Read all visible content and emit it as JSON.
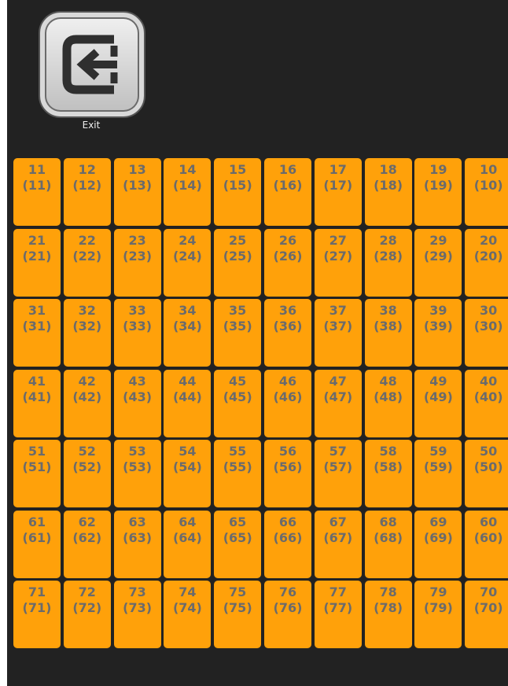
{
  "exit": {
    "label": "Exit",
    "icon": "exit-arrow-icon"
  },
  "colors": {
    "background": "#222222",
    "tile": "#ffa10a",
    "tile_text": "#6b6b6b"
  },
  "tiles": [
    {
      "num": "11",
      "sub": "(11)"
    },
    {
      "num": "12",
      "sub": "(12)"
    },
    {
      "num": "13",
      "sub": "(13)"
    },
    {
      "num": "14",
      "sub": "(14)"
    },
    {
      "num": "15",
      "sub": "(15)"
    },
    {
      "num": "16",
      "sub": "(16)"
    },
    {
      "num": "17",
      "sub": "(17)"
    },
    {
      "num": "18",
      "sub": "(18)"
    },
    {
      "num": "19",
      "sub": "(19)"
    },
    {
      "num": "10",
      "sub": "(10)"
    },
    {
      "num": "21",
      "sub": "(21)"
    },
    {
      "num": "22",
      "sub": "(22)"
    },
    {
      "num": "23",
      "sub": "(23)"
    },
    {
      "num": "24",
      "sub": "(24)"
    },
    {
      "num": "25",
      "sub": "(25)"
    },
    {
      "num": "26",
      "sub": "(26)"
    },
    {
      "num": "27",
      "sub": "(27)"
    },
    {
      "num": "28",
      "sub": "(28)"
    },
    {
      "num": "29",
      "sub": "(29)"
    },
    {
      "num": "20",
      "sub": "(20)"
    },
    {
      "num": "31",
      "sub": "(31)"
    },
    {
      "num": "32",
      "sub": "(32)"
    },
    {
      "num": "33",
      "sub": "(33)"
    },
    {
      "num": "34",
      "sub": "(34)"
    },
    {
      "num": "35",
      "sub": "(35)"
    },
    {
      "num": "36",
      "sub": "(36)"
    },
    {
      "num": "37",
      "sub": "(37)"
    },
    {
      "num": "38",
      "sub": "(38)"
    },
    {
      "num": "39",
      "sub": "(39)"
    },
    {
      "num": "30",
      "sub": "(30)"
    },
    {
      "num": "41",
      "sub": "(41)"
    },
    {
      "num": "42",
      "sub": "(42)"
    },
    {
      "num": "43",
      "sub": "(43)"
    },
    {
      "num": "44",
      "sub": "(44)"
    },
    {
      "num": "45",
      "sub": "(45)"
    },
    {
      "num": "46",
      "sub": "(46)"
    },
    {
      "num": "47",
      "sub": "(47)"
    },
    {
      "num": "48",
      "sub": "(48)"
    },
    {
      "num": "49",
      "sub": "(49)"
    },
    {
      "num": "40",
      "sub": "(40)"
    },
    {
      "num": "51",
      "sub": "(51)"
    },
    {
      "num": "52",
      "sub": "(52)"
    },
    {
      "num": "53",
      "sub": "(53)"
    },
    {
      "num": "54",
      "sub": "(54)"
    },
    {
      "num": "55",
      "sub": "(55)"
    },
    {
      "num": "56",
      "sub": "(56)"
    },
    {
      "num": "57",
      "sub": "(57)"
    },
    {
      "num": "58",
      "sub": "(58)"
    },
    {
      "num": "59",
      "sub": "(59)"
    },
    {
      "num": "50",
      "sub": "(50)"
    },
    {
      "num": "61",
      "sub": "(61)"
    },
    {
      "num": "62",
      "sub": "(62)"
    },
    {
      "num": "63",
      "sub": "(63)"
    },
    {
      "num": "64",
      "sub": "(64)"
    },
    {
      "num": "65",
      "sub": "(65)"
    },
    {
      "num": "66",
      "sub": "(66)"
    },
    {
      "num": "67",
      "sub": "(67)"
    },
    {
      "num": "68",
      "sub": "(68)"
    },
    {
      "num": "69",
      "sub": "(69)"
    },
    {
      "num": "60",
      "sub": "(60)"
    },
    {
      "num": "71",
      "sub": "(71)"
    },
    {
      "num": "72",
      "sub": "(72)"
    },
    {
      "num": "73",
      "sub": "(73)"
    },
    {
      "num": "74",
      "sub": "(74)"
    },
    {
      "num": "75",
      "sub": "(75)"
    },
    {
      "num": "76",
      "sub": "(76)"
    },
    {
      "num": "77",
      "sub": "(77)"
    },
    {
      "num": "78",
      "sub": "(78)"
    },
    {
      "num": "79",
      "sub": "(79)"
    },
    {
      "num": "70",
      "sub": "(70)"
    }
  ]
}
